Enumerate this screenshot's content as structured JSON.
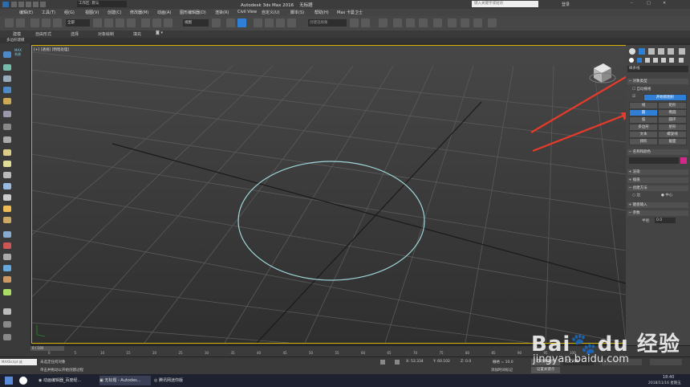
{
  "title": {
    "workspace": "工作区: 默认",
    "app": "Autodesk 3ds Max 2016",
    "file": "无标题",
    "search_placeholder": "键入关键字或短语",
    "user": "登录"
  },
  "menu": [
    "编辑(E)",
    "工具(T)",
    "组(G)",
    "视图(V)",
    "创建(C)",
    "修改器(M)",
    "动画(A)",
    "图形编辑器(D)",
    "渲染(R)",
    "Civil View",
    "自定义(U)",
    "脚本(S)",
    "帮助(H)",
    "Max 卡曼卫士"
  ],
  "toolbar": {
    "filter": "全部",
    "view": "视图",
    "named_sel": "创建选择集"
  },
  "ribbon": {
    "tabs": [
      "建模",
      "自由形式",
      "选择",
      "对象绘制",
      "填充"
    ],
    "sub": "多边形建模"
  },
  "viewport": {
    "label": "[+] [透视] [明暗处理]"
  },
  "cmd_panel": {
    "dropdown": "样条线",
    "object_type": "对象类型",
    "autogrid": "自动栅格",
    "start_new_shape": "开始新图形",
    "buttons": [
      "线",
      "矩形",
      "圆",
      "椭圆",
      "弧",
      "圆环",
      "多边形",
      "星形",
      "文本",
      "螺旋线",
      "卵形",
      "截面"
    ],
    "name_color": "名称和颜色",
    "render": "渲染",
    "interp": "插值",
    "create_method": "创建方法",
    "edge": "边",
    "center": "中心",
    "kbd_entry": "键盘输入",
    "params": "参数",
    "radius_label": "半径:",
    "radius_value": "0.0"
  },
  "timeline": {
    "counter": "0 / 100",
    "ticks": [
      "0",
      "5",
      "10",
      "15",
      "20",
      "25",
      "30",
      "35",
      "40",
      "45",
      "50",
      "55",
      "60",
      "65",
      "70",
      "75",
      "80",
      "85",
      "90",
      "95",
      "100"
    ]
  },
  "status": {
    "selection": "未选定任何对象",
    "hint": "单击并拖动以开始创建过程",
    "x": "X: 53.334",
    "y": "Y: 60.102",
    "z": "Z: 0.0",
    "grid": "栅格 = 10.0",
    "autokey": "自动关键点",
    "setkey": "设置关键点",
    "selected": "选定对象",
    "add_time_tag": "添加时间标记",
    "maxscript": "MAXScript 迷"
  },
  "taskbar": {
    "items": [
      "动画编辑器_百度经...",
      "无标题 - Autodes...",
      "腾讯网迷你版"
    ],
    "time": "18:40",
    "date": "2018/11/16 星期五"
  },
  "watermark": {
    "brand": "Bai du 经验",
    "url": "jingyan.baidu.com"
  },
  "colors": {
    "accent_blue": "#2f7fd7",
    "selection_yellow": "#d8b400",
    "circle": "#9fd6d8",
    "arrow_red": "#e83a2a",
    "color_swatch": "#d32a8a"
  }
}
